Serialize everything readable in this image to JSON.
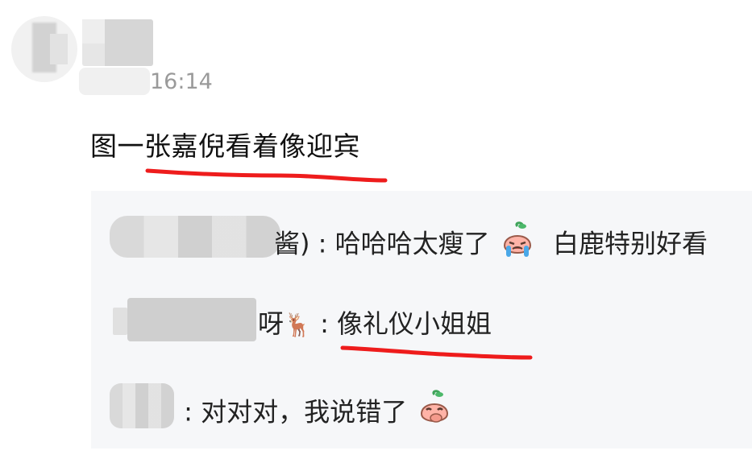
{
  "post": {
    "time": "16:14",
    "text": "图一张嘉倪看着像迎宾"
  },
  "comments": [
    {
      "name_tail": "酱)",
      "separator": " : ",
      "text_a": "哈哈哈太瘦了",
      "text_b": "白鹿特别好看",
      "emoji": "crying-face-icon"
    },
    {
      "name_tail": "呀",
      "name_emoji": "🦌",
      "separator": " : ",
      "text": "像礼仪小姐姐"
    },
    {
      "separator": " : ",
      "text": "对对对，我说错了",
      "emoji": "covering-mouth-face-icon"
    }
  ],
  "colors": {
    "underline": "#ee1c1c",
    "comment_bg": "#f6f7f9",
    "time": "#9a9a9a"
  }
}
